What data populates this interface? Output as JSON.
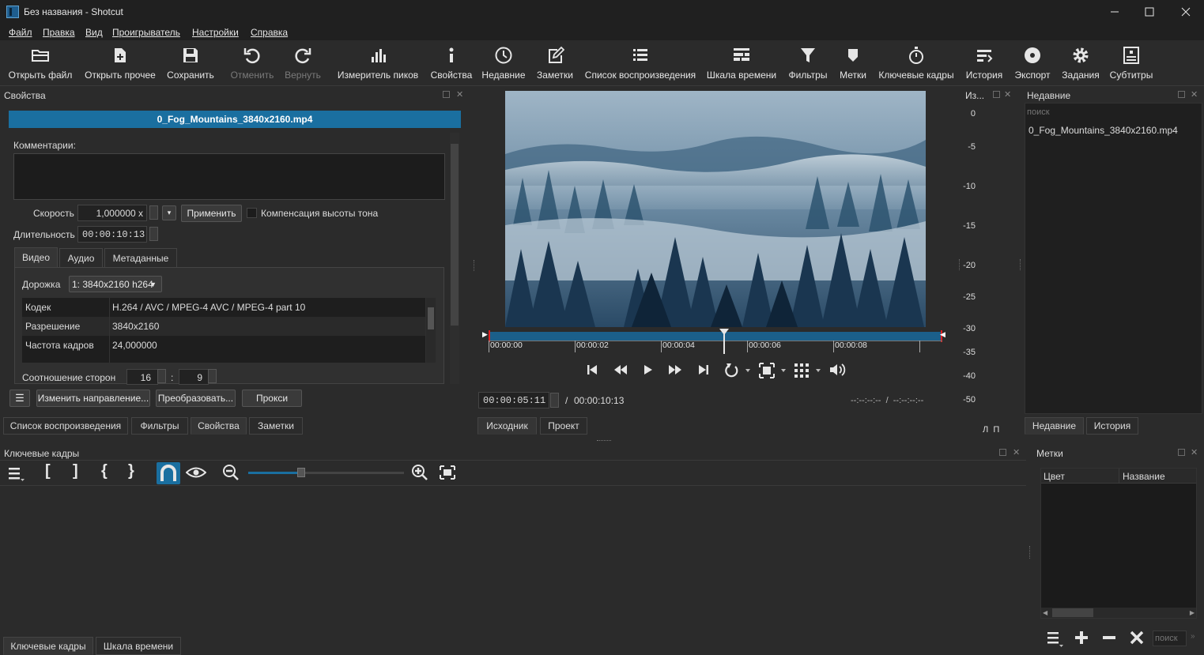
{
  "window": {
    "title": "Без названия - Shotcut"
  },
  "menu": [
    "Файл",
    "Правка",
    "Вид",
    "Проигрыватель",
    "Настройки",
    "Справка"
  ],
  "toolbar": {
    "open_file": "Открыть файл",
    "open_other": "Открыть прочее",
    "save": "Сохранить",
    "undo": "Отменить",
    "redo": "Вернуть",
    "peak_meter": "Измеритель пиков",
    "properties": "Свойства",
    "recent": "Недавние",
    "notes": "Заметки",
    "playlist": "Список воспроизведения",
    "timeline": "Шкала времени",
    "filters": "Фильтры",
    "markers": "Метки",
    "keyframes": "Ключевые кадры",
    "history": "История",
    "export": "Экспорт",
    "jobs": "Задания",
    "subtitles": "Субтитры"
  },
  "properties": {
    "title": "Свойства",
    "file_name": "0_Fog_Mountains_3840x2160.mp4",
    "comments_label": "Комментарии:",
    "speed_label": "Скорость",
    "speed_value": "1,000000 x",
    "apply_button": "Применить",
    "pitch_label": "Компенсация высоты тона",
    "duration_label": "Длительность",
    "duration_value": "00:00:10:13",
    "tabs": [
      "Видео",
      "Аудио",
      "Метаданные"
    ],
    "track_label": "Дорожка",
    "track_value": "1: 3840x2160 h264",
    "rows": [
      {
        "key": "Кодек",
        "value": "H.264 / AVC / MPEG-4 AVC / MPEG-4 part 10"
      },
      {
        "key": "Разрешение",
        "value": "3840x2160"
      },
      {
        "key": "Частота кадров",
        "value": "24,000000"
      }
    ],
    "aspect_label": "Соотношение сторон",
    "aspect_w": "16",
    "aspect_sep": ":",
    "aspect_h": "9",
    "reverse_button": "Изменить направление...",
    "convert_button": "Преобразовать...",
    "proxy_button": "Прокси"
  },
  "left_tabs": [
    "Список воспроизведения",
    "Фильтры",
    "Свойства",
    "Заметки"
  ],
  "player": {
    "ruler_labels": [
      "00:00:00",
      "00:00:02",
      "00:00:04",
      "00:00:06",
      "00:00:08"
    ],
    "playhead_fraction": 0.52,
    "current_time": "00:00:05:11",
    "time_separator": "/",
    "total_time": "00:00:10:13",
    "in_out": "--:--:--:--  /  --:--:--:--",
    "tabs": [
      "Исходник",
      "Проект"
    ]
  },
  "meter": {
    "title": "Из...",
    "labels": [
      "0",
      "-5",
      "-10",
      "-15",
      "-20",
      "-25",
      "-30",
      "-35",
      "-40",
      "-50"
    ],
    "channels": "Л  П"
  },
  "recent": {
    "title": "Недавние",
    "search_placeholder": "поиск",
    "items": [
      "0_Fog_Mountains_3840x2160.mp4"
    ],
    "tabs": [
      "Недавние",
      "История"
    ]
  },
  "keyframes": {
    "title": "Ключевые кадры"
  },
  "bottom_tabs": [
    "Ключевые кадры",
    "Шкала времени"
  ],
  "markers": {
    "title": "Метки",
    "columns": [
      "Цвет",
      "Название"
    ],
    "search_placeholder": "поиск"
  },
  "colors": {
    "accent": "#1a6fa0",
    "background": "#2b2b2b",
    "titlebar": "#202020"
  }
}
